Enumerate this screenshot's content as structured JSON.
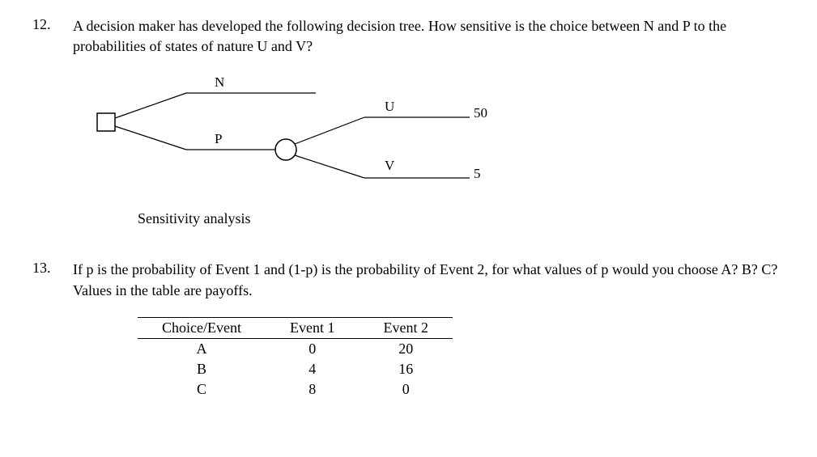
{
  "q12": {
    "number": "12.",
    "text": "A decision maker has developed the following decision tree.  How sensitive is the choice between N and P to the probabilities of states of nature U and V?",
    "diagram": {
      "labels": {
        "N": "N",
        "P": "P",
        "U": "U",
        "V": "V",
        "payoff_U": "50",
        "payoff_V": "5"
      }
    },
    "caption": "Sensitivity analysis"
  },
  "q13": {
    "number": "13.",
    "text": "If p is the probability of Event 1 and (1-p) is the probability of Event 2, for what values of p would you choose A? B? C?  Values in the table are payoffs.",
    "table": {
      "headers": [
        "Choice/Event",
        "Event 1",
        "Event 2"
      ],
      "rows": [
        {
          "choice": "A",
          "e1": "0",
          "e2": "20"
        },
        {
          "choice": "B",
          "e1": "4",
          "e2": "16"
        },
        {
          "choice": "C",
          "e1": "8",
          "e2": "0"
        }
      ]
    }
  }
}
